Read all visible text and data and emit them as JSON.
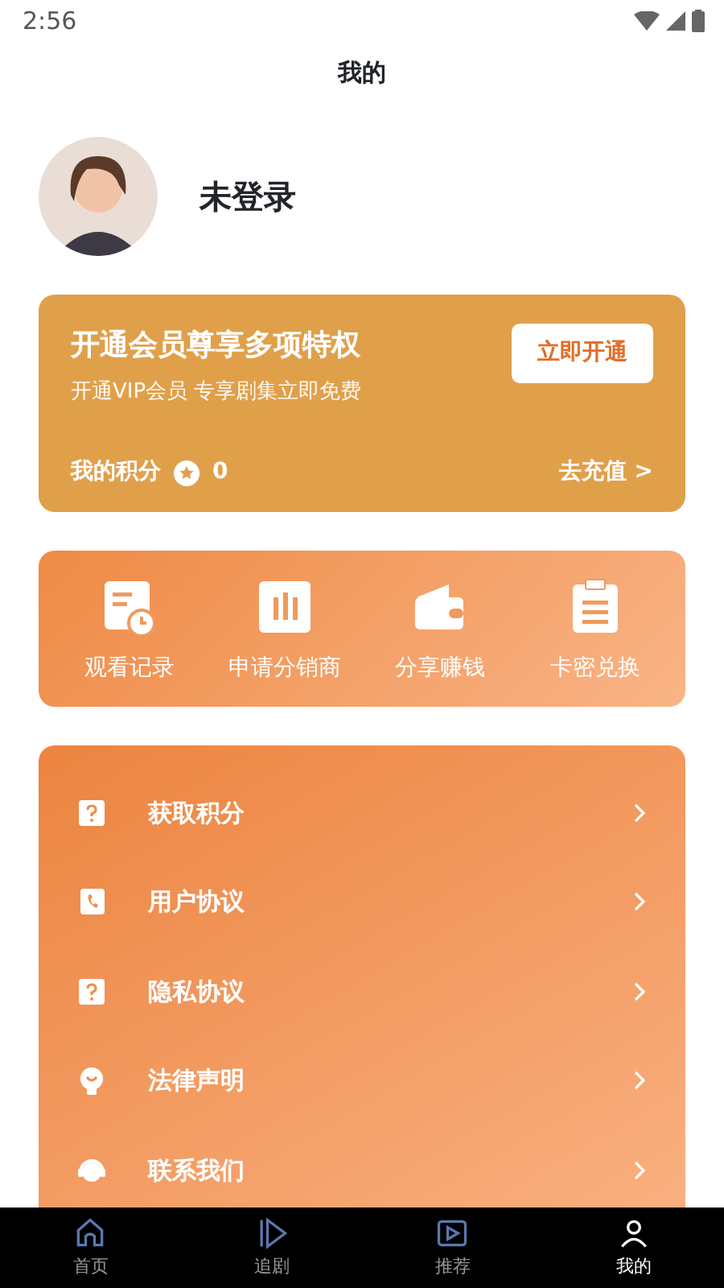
{
  "status_bar": {
    "time": "2:56"
  },
  "header": {
    "title": "我的"
  },
  "profile": {
    "name": "未登录"
  },
  "vip_card": {
    "title": "开通会员尊享多项特权",
    "subtitle": "开通VIP会员 专享剧集立即免费",
    "button": "立即开通",
    "points_label": "我的积分",
    "points": "0",
    "recharge": "去充值 >"
  },
  "shortcuts": [
    {
      "kind": "history",
      "label": "观看记录"
    },
    {
      "kind": "chart",
      "label": "申请分销商"
    },
    {
      "kind": "wallet",
      "label": "分享赚钱"
    },
    {
      "kind": "clipboard",
      "label": "卡密兑换"
    }
  ],
  "menu": [
    {
      "kind": "question",
      "label": "获取积分"
    },
    {
      "kind": "phone",
      "label": "用户协议"
    },
    {
      "kind": "question",
      "label": "隐私协议"
    },
    {
      "kind": "bulb",
      "label": "法律声明"
    },
    {
      "kind": "headset",
      "label": "联系我们"
    }
  ],
  "bottom_nav": [
    {
      "kind": "home",
      "label": "首页",
      "selected": false
    },
    {
      "kind": "play",
      "label": "追剧",
      "selected": false
    },
    {
      "kind": "video",
      "label": "推荐",
      "selected": false
    },
    {
      "kind": "person",
      "label": "我的",
      "selected": true
    }
  ]
}
